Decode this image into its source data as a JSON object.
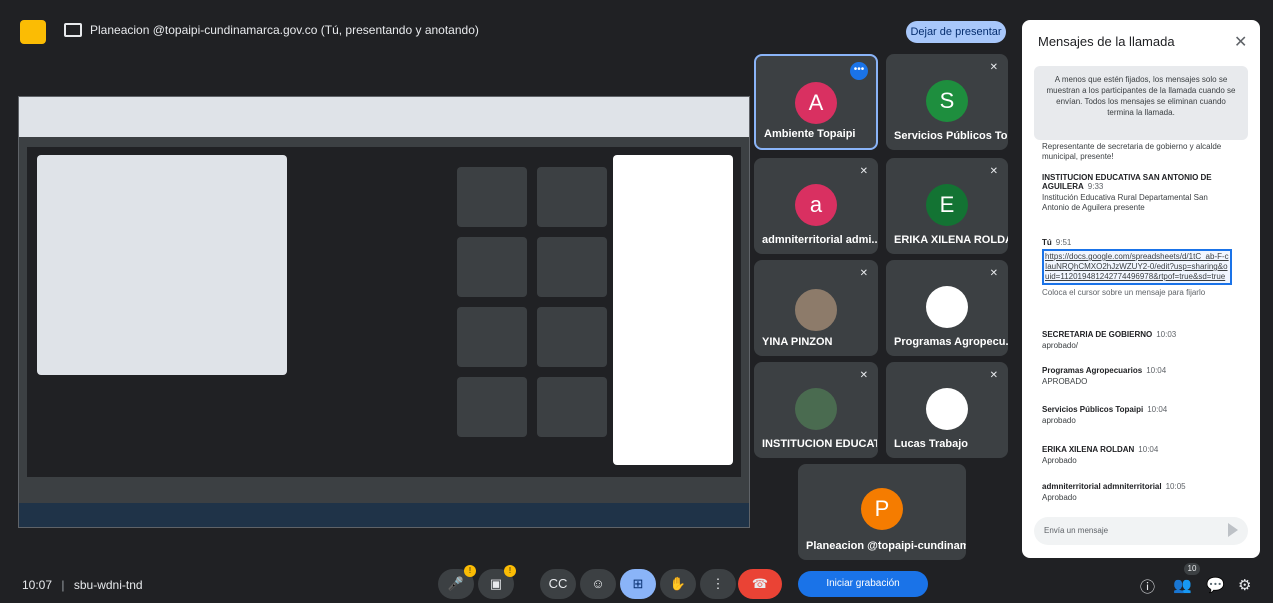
{
  "present_bar": {
    "title": "Planeacion @topaipi-cundinamarca.gov.co (Tú, presentando y anotando)",
    "stop_label": "Dejar de presentar"
  },
  "tiles": [
    {
      "name": "Ambiente Topaipi",
      "initial": "A",
      "color": "#d93061"
    },
    {
      "name": "Servicios Públicos To...",
      "initial": "S",
      "color": "#1e8e3e"
    },
    {
      "name": "admniterritorial admi...",
      "initial": "a",
      "color": "#d93061"
    },
    {
      "name": "ERIKA XILENA ROLDAN",
      "initial": "E",
      "color": "#137333"
    },
    {
      "name": "YINA PINZON",
      "initial": "",
      "color": "#5f6368"
    },
    {
      "name": "Programas Agropecu...",
      "initial": "",
      "color": "#ffffff"
    },
    {
      "name": "INSTITUCION EDUCAT...",
      "initial": "",
      "color": "#5f6368"
    },
    {
      "name": "Lucas Trabajo",
      "initial": "",
      "color": "#ffffff"
    },
    {
      "name": "Planeacion @topaipi-cundinam...",
      "initial": "P",
      "color": "#f57c00"
    }
  ],
  "chat": {
    "title": "Mensajes de la llamada",
    "notice": "A menos que estén fijados, los mensajes solo se muestran a los participantes de la llamada cuando se envían. Todos los mensajes se eliminan cuando termina la llamada.",
    "messages": [
      {
        "sender": "",
        "time": "",
        "text": "Representante de secretaria de gobierno y alcalde municipal, presente!"
      },
      {
        "sender": "INSTITUCION EDUCATIVA SAN ANTONIO DE AGUILERA",
        "time": "9:33",
        "text": "Institución Educativa Rural Departamental San Antonio de Aguilera presente"
      },
      {
        "sender": "Tú",
        "time": "9:51",
        "text": "https://docs.google.com/spreadsheets/d/1tC_ab-F-cIauNRQhCMXO2hJzWZUY2-0/edit?usp=sharing&ouid=112019481242774496978&rtpof=true&sd=true",
        "hint": "Coloca el cursor sobre un mensaje para fijarlo"
      },
      {
        "sender": "SECRETARIA DE GOBIERNO",
        "time": "10:03",
        "text": "aprobado/"
      },
      {
        "sender": "Programas Agropecuarios",
        "time": "10:04",
        "text": "APROBADO"
      },
      {
        "sender": "Servicios Públicos Topaipi",
        "time": "10:04",
        "text": "aprobado"
      },
      {
        "sender": "ERIKA XILENA ROLDAN",
        "time": "10:04",
        "text": "Aprobado"
      },
      {
        "sender": "admniterritorial admniterritorial",
        "time": "10:05",
        "text": "Aprobado"
      }
    ],
    "input_placeholder": "Envía un mensaje"
  },
  "bottom": {
    "time": "10:07",
    "meeting_code": "sbu-wdni-tnd",
    "record_label": "Iniciar grabación",
    "participant_count": "10"
  },
  "icons": {
    "present": "present-screen-icon",
    "mic": "mic-icon",
    "camera": "camera-icon",
    "captions": "captions-icon",
    "emoji": "emoji-icon",
    "share": "present-screen-icon",
    "hand": "raise-hand-icon",
    "more": "more-vert-icon",
    "hangup": "hangup-icon",
    "info": "info-icon",
    "people": "people-icon",
    "chat": "chat-icon",
    "activities": "activities-icon"
  },
  "colors": {
    "accent": "#8ab4f8",
    "hangup": "#ea4335",
    "bg": "#202124"
  }
}
